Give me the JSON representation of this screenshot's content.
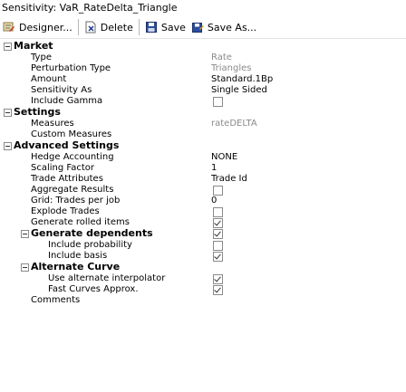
{
  "window": {
    "title": "Sensitivity: VaR_RateDelta_Triangle"
  },
  "toolbar": {
    "designer_label": "Designer...",
    "delete_label": "Delete",
    "save_label": "Save",
    "save_as_label": "Save As..."
  },
  "sections": {
    "market": "Market",
    "settings": "Settings",
    "advanced": "Advanced Settings",
    "generate_dependents": "Generate dependents",
    "alternate_curve": "Alternate Curve"
  },
  "fields": {
    "type": {
      "label": "Type",
      "value": "Rate"
    },
    "perturbation_type": {
      "label": "Perturbation Type",
      "value": "Triangles"
    },
    "amount": {
      "label": "Amount",
      "value": "Standard.1Bp"
    },
    "sensitivity_as": {
      "label": "Sensitivity As",
      "value": "Single Sided"
    },
    "include_gamma": {
      "label": "Include Gamma",
      "checked": false
    },
    "measures": {
      "label": "Measures",
      "value": "rateDELTA"
    },
    "custom_measures": {
      "label": "Custom Measures",
      "value": ""
    },
    "hedge_accounting": {
      "label": "Hedge Accounting",
      "value": "NONE"
    },
    "scaling_factor": {
      "label": "Scaling Factor",
      "value": "1"
    },
    "trade_attributes": {
      "label": "Trade Attributes",
      "value": "Trade Id"
    },
    "aggregate_results": {
      "label": "Aggregate Results",
      "checked": false
    },
    "trades_per_job": {
      "label": "Grid: Trades per job",
      "value": "0"
    },
    "explode_trades": {
      "label": "Explode Trades",
      "checked": false
    },
    "generate_rolled_items": {
      "label": "Generate rolled items",
      "checked": true
    },
    "include_probability": {
      "label": "Include probability",
      "checked": false
    },
    "include_basis": {
      "label": "Include basis",
      "checked": true
    },
    "use_alternate_interpolator": {
      "label": "Use alternate interpolator",
      "checked": true
    },
    "fast_curves_approx": {
      "label": "Fast Curves Approx.",
      "checked": true
    },
    "comments": {
      "label": "Comments",
      "value": ""
    }
  },
  "icons": {
    "designer": "designer-icon",
    "delete": "delete-icon",
    "save": "save-icon",
    "save_as": "save-as-icon",
    "collapse": "collapse-icon"
  }
}
